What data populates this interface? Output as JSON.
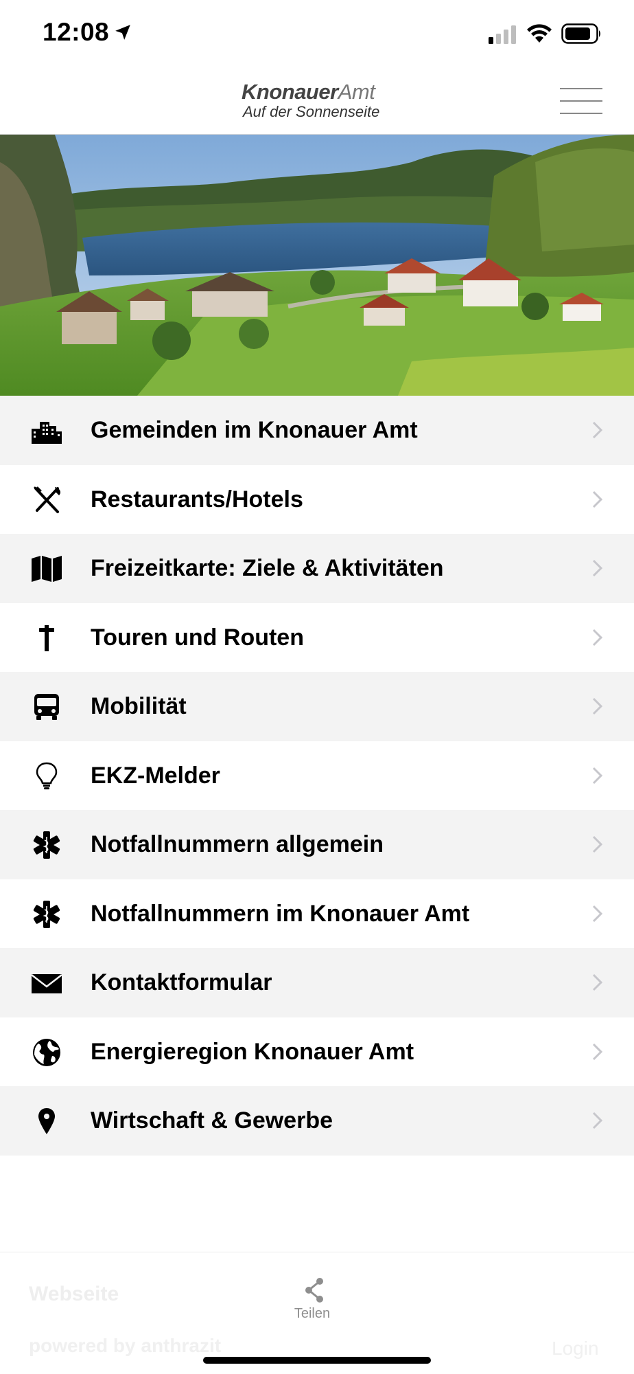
{
  "status_bar": {
    "time": "12:08",
    "icons": [
      "location-arrow-icon",
      "signal-icon",
      "wifi-icon",
      "battery-icon"
    ]
  },
  "header": {
    "logo_bold": "Knonauer",
    "logo_light": "Amt",
    "logo_tagline": "Auf der Sonnenseite",
    "menu_icon": "hamburger-menu-icon"
  },
  "hero": {
    "description_icon": "landscape-photo"
  },
  "menu": {
    "items": [
      {
        "label": "Gemeinden im Knonauer Amt",
        "icon": "city-buildings-icon"
      },
      {
        "label": "Restaurants/Hotels",
        "icon": "fork-knife-icon"
      },
      {
        "label": "Freizeitkarte: Ziele & Aktivitäten",
        "icon": "map-icon"
      },
      {
        "label": "Touren und Routen",
        "icon": "signpost-icon"
      },
      {
        "label": "Mobilität",
        "icon": "bus-icon"
      },
      {
        "label": "EKZ-Melder",
        "icon": "lightbulb-icon"
      },
      {
        "label": "Notfallnummern allgemein",
        "icon": "star-of-life-icon"
      },
      {
        "label": "Notfallnummern im Knonauer Amt",
        "icon": "star-of-life-icon"
      },
      {
        "label": "Kontaktformular",
        "icon": "envelope-icon"
      },
      {
        "label": "Energieregion Knonauer Amt",
        "icon": "globe-icon"
      },
      {
        "label": "Wirtschaft & Gewerbe",
        "icon": "map-pin-icon"
      }
    ]
  },
  "bottom": {
    "share_label": "Teilen",
    "faded_webseite": "Webseite",
    "faded_powered": "powered by anthrazit",
    "faded_login": "Login"
  },
  "colors": {
    "row_shaded": "#f3f3f3",
    "row_plain": "#ffffff",
    "chevron": "#c7c7cc",
    "share_gray": "#8e8e8e"
  }
}
